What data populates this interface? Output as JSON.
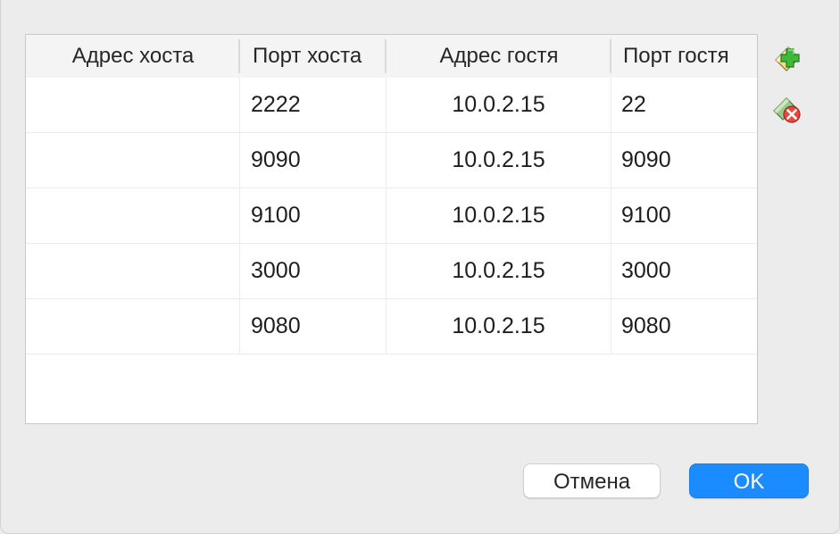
{
  "table": {
    "columns": [
      "Адрес хоста",
      "Порт хоста",
      "Адрес гостя",
      "Порт гостя"
    ],
    "rows": [
      {
        "host_address": "",
        "host_port": "2222",
        "guest_address": "10.0.2.15",
        "guest_port": "22"
      },
      {
        "host_address": "",
        "host_port": "9090",
        "guest_address": "10.0.2.15",
        "guest_port": "9090"
      },
      {
        "host_address": "",
        "host_port": "9100",
        "guest_address": "10.0.2.15",
        "guest_port": "9100"
      },
      {
        "host_address": "",
        "host_port": "3000",
        "guest_address": "10.0.2.15",
        "guest_port": "3000"
      },
      {
        "host_address": "",
        "host_port": "9080",
        "guest_address": "10.0.2.15",
        "guest_port": "9080"
      }
    ]
  },
  "side_buttons": {
    "add_icon": "add-rule-icon",
    "remove_icon": "remove-rule-icon"
  },
  "buttons": {
    "cancel": "Отмена",
    "ok": "OK"
  },
  "colors": {
    "accent": "#1a8cff",
    "add_green": "#3fb93a",
    "remove_red": "#e8473e"
  }
}
